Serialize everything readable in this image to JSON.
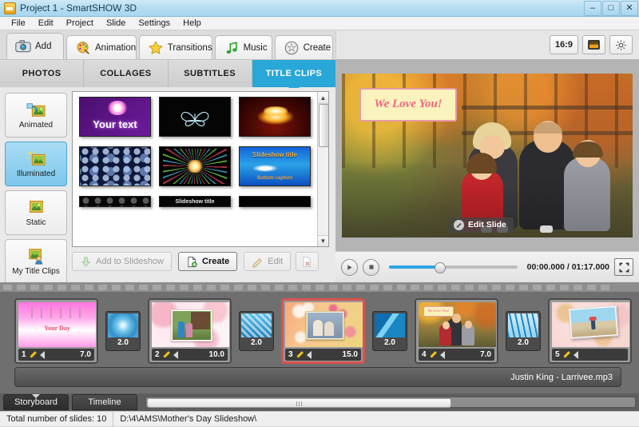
{
  "window": {
    "title": "Project 1 - SmartSHOW 3D",
    "minimize": "–",
    "maximize": "□",
    "close": "✕"
  },
  "menu": [
    "File",
    "Edit",
    "Project",
    "Slide",
    "Settings",
    "Help"
  ],
  "ribbon_tabs": [
    {
      "label": "Add",
      "icon": "camera-icon",
      "active": true
    },
    {
      "label": "Animation",
      "icon": "palette-icon",
      "active": false
    },
    {
      "label": "Transitions",
      "icon": "star-icon",
      "active": false
    },
    {
      "label": "Music",
      "icon": "music-note-icon",
      "active": false
    },
    {
      "label": "Create",
      "icon": "disc-icon",
      "active": false
    }
  ],
  "sub_tabs": [
    {
      "label": "PHOTOS",
      "active": false
    },
    {
      "label": "COLLAGES",
      "active": false
    },
    {
      "label": "SUBTITLES",
      "active": false
    },
    {
      "label": "TITLE CLIPS",
      "active": true
    }
  ],
  "categories": [
    {
      "label": "Animated",
      "icon": "animated-frame-icon",
      "active": false
    },
    {
      "label": "Illuminated",
      "icon": "illuminated-frame-icon",
      "active": true
    },
    {
      "label": "Static",
      "icon": "static-frame-icon",
      "active": false
    },
    {
      "label": "My Title Clips",
      "icon": "user-frame-icon",
      "active": false
    }
  ],
  "thumbnails": [
    {
      "name": "your-text-heart",
      "caption": "Your text"
    },
    {
      "name": "butterfly-outline",
      "caption": ""
    },
    {
      "name": "golden-fire-burst",
      "caption": ""
    },
    {
      "name": "blue-snow-particles",
      "caption": ""
    },
    {
      "name": "color-starburst",
      "caption": ""
    },
    {
      "name": "slideshow-title-blue",
      "caption": "Slideshow title",
      "subcaption": "Bottom caption"
    },
    {
      "name": "dark-particles-partial",
      "caption": ""
    },
    {
      "name": "slideshow-title-dark-partial",
      "caption": "Slideshow title"
    },
    {
      "name": "black-partial",
      "caption": ""
    }
  ],
  "actions": {
    "add_to_slideshow": "Add to Slideshow",
    "create": "Create",
    "edit": "Edit",
    "delete": "✕"
  },
  "preview": {
    "aspect_ratio": "16:9",
    "screen_icon": "widescreen-icon",
    "settings_icon": "gear-icon",
    "overlay_text": "We Love You!",
    "edit_slide": "Edit Slide"
  },
  "player": {
    "play_icon": "play-icon",
    "stop_icon": "stop-icon",
    "timecode": "00:00.000 / 01:17.000",
    "fullscreen_icon": "fullscreen-icon",
    "progress_percent": 39
  },
  "storyboard": {
    "slides": [
      {
        "number": "1",
        "duration": "7.0",
        "selected": false,
        "name": "your-day-pink-title"
      },
      {
        "number": "2",
        "duration": "10.0",
        "selected": false,
        "name": "couple-cabin-photo"
      },
      {
        "number": "3",
        "duration": "15.0",
        "selected": true,
        "name": "blossom-kids-photo"
      },
      {
        "number": "4",
        "duration": "7.0",
        "selected": false,
        "name": "family-autumn-photo"
      },
      {
        "number": "5",
        "duration": "",
        "selected": false,
        "name": "beach-photo"
      }
    ],
    "transitions": [
      {
        "duration": "2.0",
        "name": "blue-swirl-transition"
      },
      {
        "duration": "2.0",
        "name": "blue-checker-transition"
      },
      {
        "duration": "2.0",
        "name": "blue-diagonal-transition"
      },
      {
        "duration": "2.0",
        "name": "blue-ink-transition"
      }
    ],
    "music_track": "Justin King - Larrivee.mp3"
  },
  "bottom_tabs": [
    {
      "label": "Storyboard",
      "active": true
    },
    {
      "label": "Timeline",
      "active": false
    }
  ],
  "status": {
    "slide_count": "Total number of slides: 10",
    "project_path": "D:\\4\\AMS\\Mother's Day Slideshow\\"
  },
  "colors": {
    "accent": "#29a7d8",
    "titlebar": "#b2dcf2",
    "selection": "#d9534f",
    "progress": "#2aa6e0"
  }
}
